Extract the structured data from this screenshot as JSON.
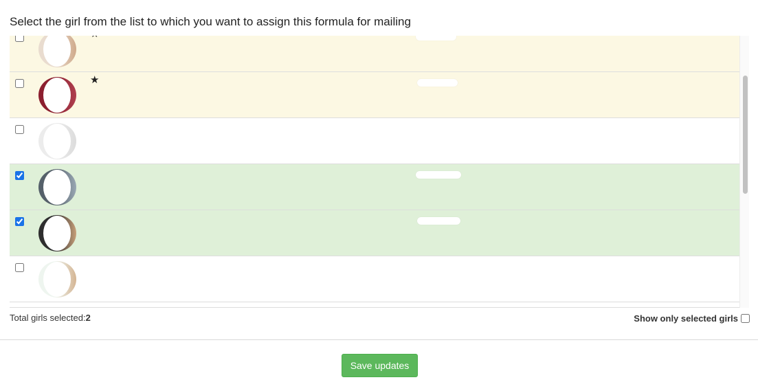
{
  "heading": "Select the girl from the list to which you want to assign this formula for mailing",
  "star_glyph": "★",
  "rows": [
    {
      "checked": false,
      "favorite": true,
      "avatar_colors": [
        "#e9dccf",
        "#cfa98a"
      ]
    },
    {
      "checked": false,
      "favorite": true,
      "avatar_colors": [
        "#8c1f2f",
        "#b04050"
      ]
    },
    {
      "checked": false,
      "favorite": false,
      "avatar_colors": [
        "#ececec",
        "#dcdcdc"
      ]
    },
    {
      "checked": true,
      "favorite": false,
      "avatar_colors": [
        "#55606a",
        "#9aa8b4"
      ]
    },
    {
      "checked": true,
      "favorite": false,
      "avatar_colors": [
        "#2e2e2e",
        "#c8a07a"
      ]
    },
    {
      "checked": false,
      "favorite": false,
      "avatar_colors": [
        "#eef5ef",
        "#d4b492"
      ]
    }
  ],
  "footer": {
    "total_label": "Total girls selected:",
    "total_count": "2",
    "show_only_label": "Show only selected girls",
    "show_only_checked": false
  },
  "save_button": {
    "label": "Save updates"
  },
  "colors": {
    "favorite_row": "#fcf8e3",
    "selected_row": "#dff0d8",
    "save_button": "#5cb85c"
  }
}
